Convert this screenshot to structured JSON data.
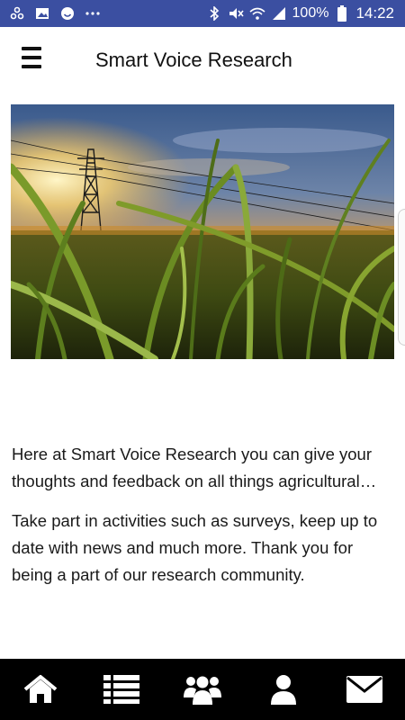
{
  "status_bar": {
    "left_icons": [
      "pinwheel-icon",
      "image-icon",
      "smiley-icon",
      "more-dots-icon"
    ],
    "right_icons": [
      "bluetooth-icon",
      "mute-icon",
      "wifi-icon",
      "signal-icon",
      "battery-icon"
    ],
    "battery": "100%",
    "time": "14:22",
    "color": "#3b4fa1"
  },
  "header": {
    "title": "Smart Voice Research",
    "menu_icon": "hamburger-menu-icon"
  },
  "hero": {
    "icon": "sunset-field-image"
  },
  "content": {
    "paragraphs": [
      "Here at Smart Voice Research you can give your thoughts and feedback on all things agricultural…",
      "Take part in activities such as surveys, keep up to date with news and much more. Thank you for being a part of our research community."
    ]
  },
  "bottom_nav": {
    "items": [
      {
        "icon": "home-icon"
      },
      {
        "icon": "list-icon"
      },
      {
        "icon": "community-icon"
      },
      {
        "icon": "profile-icon"
      },
      {
        "icon": "mail-icon"
      }
    ],
    "background": "#000000"
  }
}
